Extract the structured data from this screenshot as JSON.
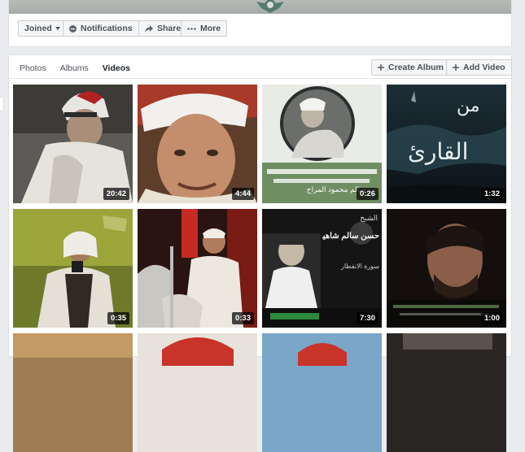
{
  "actions": {
    "joined_label": "Joined",
    "notifications_label": "Notifications",
    "share_label": "Share",
    "more_label": "More"
  },
  "tabs": [
    {
      "label": "Photos",
      "active": false
    },
    {
      "label": "Albums",
      "active": false
    },
    {
      "label": "Videos",
      "active": true
    }
  ],
  "toolbar": {
    "create_album_label": "Create Album",
    "add_video_label": "Add Video"
  },
  "videos": [
    {
      "duration": "20:42"
    },
    {
      "duration": "4:44"
    },
    {
      "duration": "0:26",
      "caption_ar": "سالم محمود المراح"
    },
    {
      "duration": "1:32",
      "title_ar_top": "من",
      "title_ar_bottom": "القارئ"
    },
    {
      "duration": "0:35"
    },
    {
      "duration": "0:33"
    },
    {
      "duration": "7:30",
      "caption_top": "الشيخ",
      "caption_name": "حسن سالم شاهين",
      "caption_sub": "سورة الانفطار"
    },
    {
      "duration": "1:00"
    },
    {
      "duration": ""
    },
    {
      "duration": ""
    },
    {
      "duration": ""
    },
    {
      "duration": ""
    }
  ],
  "colors": {
    "page_bg": "#e9ebee",
    "panel_bg": "#ffffff",
    "button_bg": "#f5f6f7",
    "text_primary": "#1d2129",
    "text_secondary": "#4b4f56"
  }
}
